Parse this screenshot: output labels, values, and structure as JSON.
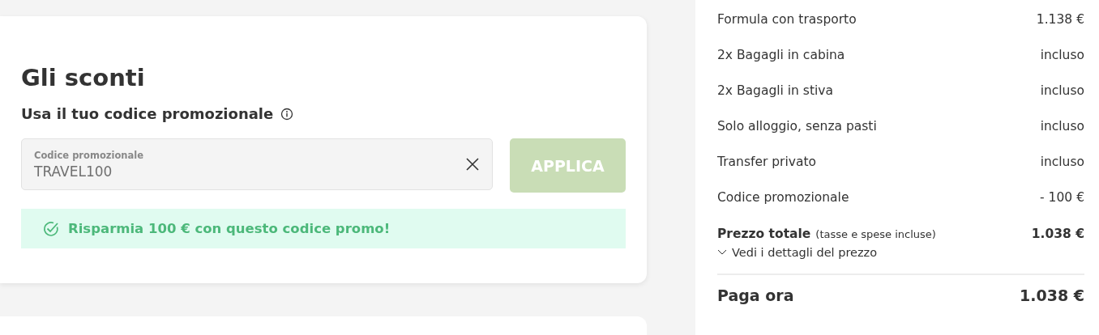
{
  "discounts": {
    "title": "Gli sconti",
    "subtitle": "Usa il tuo codice promozionale",
    "promo_field": {
      "label": "Codice promozionale",
      "value": "TRAVEL100"
    },
    "apply_button": {
      "label": "APPLICA",
      "disabled": true
    },
    "success_message": "Risparmia 100 € con questo codice promo!"
  },
  "summary": {
    "lines": [
      {
        "label": "Formula con trasporto",
        "value": "1.138 €"
      },
      {
        "label": "2x Bagagli in cabina",
        "value": "incluso"
      },
      {
        "label": "2x Bagagli in stiva",
        "value": "incluso"
      },
      {
        "label": "Solo alloggio, senza pasti",
        "value": "incluso"
      },
      {
        "label": "Transfer privato",
        "value": "incluso"
      },
      {
        "label": "Codice promozionale",
        "value": "- 100 €"
      }
    ],
    "total": {
      "label": "Prezzo totale",
      "note": "(tasse e spese incluse)",
      "value": "1.038 €"
    },
    "details_link": "Vedi i dettagli del prezzo",
    "pay_now": {
      "label": "Paga ora",
      "value": "1.038 €"
    }
  }
}
